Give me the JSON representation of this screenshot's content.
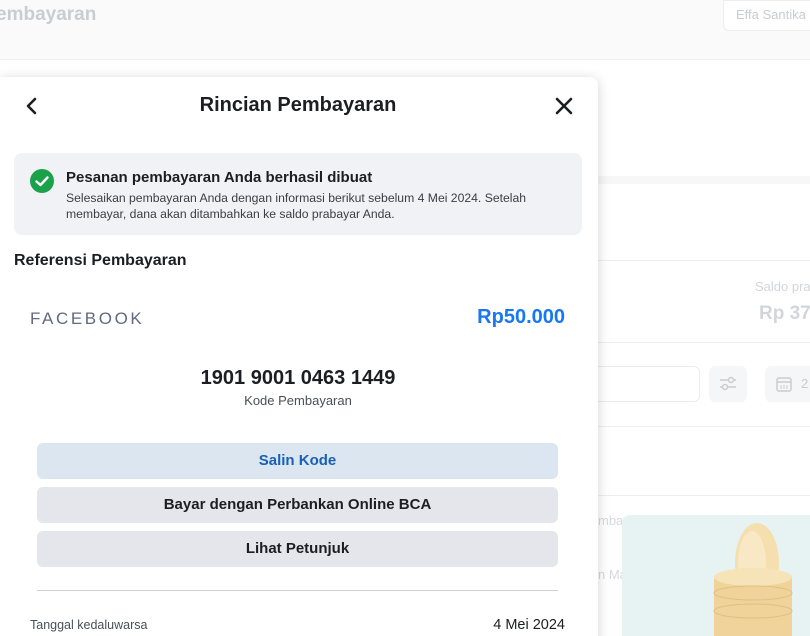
{
  "background": {
    "page_title": "embayaran",
    "user_name": "Effa Santika",
    "saldo_label": "Saldo pra",
    "saldo_value": "Rp 37",
    "date_partial": "2",
    "row_text_1": "mbay",
    "row_text_2": "n Ma"
  },
  "modal": {
    "title": "Rincian Pembayaran",
    "back_icon": "chevron-left-icon",
    "close_icon": "close-icon"
  },
  "notice": {
    "icon": "check-circle-icon",
    "icon_color": "#1aa14a",
    "title": "Pesanan pembayaran Anda berhasil dibuat",
    "body": "Selesaikan pembayaran Anda dengan informasi berikut sebelum 4 Mei 2024. Setelah membayar, dana akan ditambahkan ke saldo prabayar Anda."
  },
  "reference": {
    "section_title": "Referensi Pembayaran",
    "merchant": "FACEBOOK",
    "amount": "Rp50.000",
    "amount_color": "#1877f2",
    "payment_code": "1901 9001 0463 1449",
    "payment_code_label": "Kode Pembayaran"
  },
  "actions": {
    "copy_code": "Salin Kode",
    "pay_bca": "Bayar dengan Perbankan Online BCA",
    "view_instructions": "Lihat Petunjuk"
  },
  "expiry": {
    "label": "Tanggal kedaluwarsa",
    "value": "4 Mei 2024"
  }
}
